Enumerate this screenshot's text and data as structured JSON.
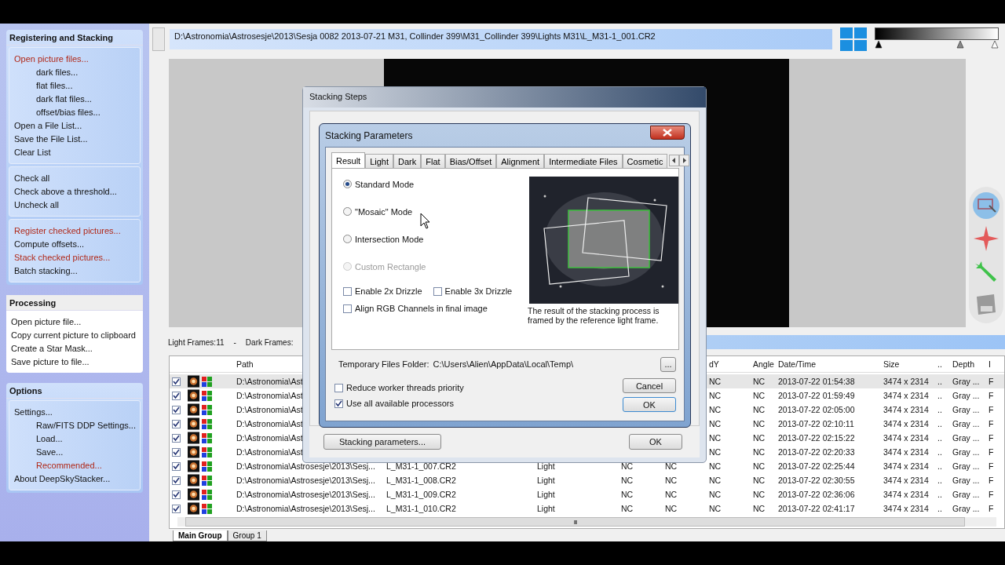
{
  "path_bar": {
    "text": "D:\\Astronomia\\Astrosesje\\2013\\Sesja 0082 2013-07-21 M31, Collinder 399\\M31_Collinder 399\\Lights M31\\L_M31-1_001.CR2"
  },
  "sidebar": [
    {
      "title": "Registering and Stacking",
      "kind": "blue",
      "groups": [
        {
          "items": [
            {
              "label": "Open picture files...",
              "highlighted": true,
              "children": [
                {
                  "label": "dark files...",
                  "highlighted": false
                },
                {
                  "label": "flat files...",
                  "highlighted": false
                },
                {
                  "label": "dark flat files...",
                  "highlighted": false
                },
                {
                  "label": "offset/bias files...",
                  "highlighted": false
                }
              ]
            },
            {
              "label": "Open a File List...",
              "highlighted": false
            },
            {
              "label": "Save the File List...",
              "highlighted": false
            },
            {
              "label": "Clear List",
              "highlighted": false
            }
          ]
        },
        {
          "items": [
            {
              "label": "Check all",
              "highlighted": false
            },
            {
              "label": "Check above a threshold...",
              "highlighted": false
            },
            {
              "label": "Uncheck all",
              "highlighted": false
            }
          ]
        },
        {
          "items": [
            {
              "label": "Register checked pictures...",
              "highlighted": true
            },
            {
              "label": "Compute offsets...",
              "highlighted": false
            },
            {
              "label": "Stack checked pictures...",
              "highlighted": true
            },
            {
              "label": "Batch stacking...",
              "highlighted": false
            }
          ]
        }
      ]
    },
    {
      "title": "Processing",
      "kind": "gray",
      "groups": [
        {
          "items": [
            {
              "label": "Open picture file...",
              "highlighted": false
            },
            {
              "label": "Copy current picture to clipboard",
              "highlighted": false
            },
            {
              "label": "Create a Star Mask...",
              "highlighted": false
            },
            {
              "label": "Save picture to file...",
              "highlighted": false
            }
          ]
        }
      ]
    },
    {
      "title": "Options",
      "kind": "blue",
      "groups": [
        {
          "items": [
            {
              "label": "Settings...",
              "highlighted": false,
              "children": [
                {
                  "label": "Raw/FITS DDP Settings...",
                  "highlighted": false
                },
                {
                  "label": "Load...",
                  "highlighted": false
                },
                {
                  "label": "Save...",
                  "highlighted": false
                },
                {
                  "label": "Recommended...",
                  "highlighted": true
                }
              ]
            },
            {
              "label": "About DeepSkyStacker...",
              "highlighted": false
            }
          ]
        }
      ]
    }
  ],
  "status": {
    "light_frames": "Light Frames:11",
    "separator": "-",
    "dark_frames": "Dark Frames:"
  },
  "table": {
    "columns": {
      "path": "Path",
      "dy": "dY",
      "angle": "Angle",
      "datetime": "Date/Time",
      "size": "Size",
      "dots": "..",
      "depth": "Depth",
      "column_12": "I"
    },
    "rows": [
      {
        "checked": true,
        "selected": true,
        "path": "D:\\Astronomia\\Ast",
        "dy": "NC",
        "angle": "NC",
        "datetime": "2013-07-22 01:54:38",
        "size": "3474 x 2314",
        "dots": "..",
        "depth": "Gray ...",
        "column_12": "F"
      },
      {
        "checked": true,
        "selected": false,
        "path": "D:\\Astronomia\\Ast",
        "dy": "NC",
        "angle": "NC",
        "datetime": "2013-07-22 01:59:49",
        "size": "3474 x 2314",
        "dots": "..",
        "depth": "Gray ...",
        "column_12": "F"
      },
      {
        "checked": true,
        "selected": false,
        "path": "D:\\Astronomia\\Ast",
        "dy": "NC",
        "angle": "NC",
        "datetime": "2013-07-22 02:05:00",
        "size": "3474 x 2314",
        "dots": "..",
        "depth": "Gray ...",
        "column_12": "F"
      },
      {
        "checked": true,
        "selected": false,
        "path": "D:\\Astronomia\\Ast",
        "dy": "NC",
        "angle": "NC",
        "datetime": "2013-07-22 02:10:11",
        "size": "3474 x 2314",
        "dots": "..",
        "depth": "Gray ...",
        "column_12": "F"
      },
      {
        "checked": true,
        "selected": false,
        "path": "D:\\Astronomia\\Ast",
        "dy": "NC",
        "angle": "NC",
        "datetime": "2013-07-22 02:15:22",
        "size": "3474 x 2314",
        "dots": "..",
        "depth": "Gray ...",
        "column_12": "F"
      },
      {
        "checked": true,
        "selected": false,
        "path": "D:\\Astronomia\\Ast",
        "dy": "NC",
        "angle": "NC",
        "datetime": "2013-07-22 02:20:33",
        "size": "3474 x 2314",
        "dots": "..",
        "depth": "Gray ...",
        "column_12": "F"
      },
      {
        "checked": true,
        "selected": false,
        "path": "D:\\Astronomia\\Astrosesje\\2013\\Sesj...",
        "column_2": "L_M31-1_007.CR2",
        "column_3": "Light",
        "column_4": "NC",
        "column_5": "NC",
        "dy": "NC",
        "angle": "NC",
        "datetime": "2013-07-22 02:25:44",
        "size": "3474 x 2314",
        "dots": "..",
        "depth": "Gray ...",
        "column_12": "F"
      },
      {
        "checked": true,
        "selected": false,
        "path": "D:\\Astronomia\\Astrosesje\\2013\\Sesj...",
        "column_2": "L_M31-1_008.CR2",
        "column_3": "Light",
        "column_4": "NC",
        "column_5": "NC",
        "dy": "NC",
        "angle": "NC",
        "datetime": "2013-07-22 02:30:55",
        "size": "3474 x 2314",
        "dots": "..",
        "depth": "Gray ...",
        "column_12": "F"
      },
      {
        "checked": true,
        "selected": false,
        "path": "D:\\Astronomia\\Astrosesje\\2013\\Sesj...",
        "column_2": "L_M31-1_009.CR2",
        "column_3": "Light",
        "column_4": "NC",
        "column_5": "NC",
        "dy": "NC",
        "angle": "NC",
        "datetime": "2013-07-22 02:36:06",
        "size": "3474 x 2314",
        "dots": "..",
        "depth": "Gray ...",
        "column_12": "F"
      },
      {
        "checked": true,
        "selected": false,
        "path": "D:\\Astronomia\\Astrosesje\\2013\\Sesj...",
        "column_2": "L_M31-1_010.CR2",
        "column_3": "Light",
        "column_4": "NC",
        "column_5": "NC",
        "dy": "NC",
        "angle": "NC",
        "datetime": "2013-07-22 02:41:17",
        "size": "3474 x 2314",
        "dots": "..",
        "depth": "Gray ...",
        "column_12": "F"
      }
    ]
  },
  "scroll_grip": "III",
  "gradient_slider": {
    "handles": [
      {
        "level": 0
      },
      {
        "level": 0.7
      },
      {
        "level": 1
      }
    ]
  },
  "group_tabs": [
    {
      "label": "Main Group",
      "selected": true
    },
    {
      "label": "Group 1",
      "selected": false
    }
  ],
  "stacking_steps": {
    "title": "Stacking Steps",
    "parameters_button": "Stacking parameters...",
    "ok_button": "OK"
  },
  "stacking_parameters": {
    "title": "Stacking Parameters",
    "tabs": [
      {
        "label": "Result",
        "selected": true
      },
      {
        "label": "Light",
        "selected": false
      },
      {
        "label": "Dark",
        "selected": false
      },
      {
        "label": "Flat",
        "selected": false
      },
      {
        "label": "Bias/Offset",
        "selected": false
      },
      {
        "label": "Alignment",
        "selected": false
      },
      {
        "label": "Intermediate Files",
        "selected": false
      },
      {
        "label": "Cosmetic",
        "selected": false
      }
    ],
    "modes": [
      {
        "label": "Standard Mode",
        "selected": true,
        "disabled": false
      },
      {
        "label": "\"Mosaic\" Mode",
        "selected": false,
        "disabled": false
      },
      {
        "label": "Intersection Mode",
        "selected": false,
        "disabled": false
      },
      {
        "label": "Custom Rectangle",
        "selected": false,
        "disabled": true
      }
    ],
    "drizzle": [
      {
        "label": "Enable 2x Drizzle",
        "checked": false
      },
      {
        "label": "Enable 3x Drizzle",
        "checked": false
      }
    ],
    "align_rgb": {
      "label": "Align RGB Channels in final image",
      "checked": false
    },
    "preview_caption": "The result of the stacking process is framed by the reference light frame.",
    "temp_folder_label": "Temporary Files Folder:",
    "temp_folder_path": "C:\\Users\\Alien\\AppData\\Local\\Temp\\",
    "browse_button": "...",
    "processing": [
      {
        "label": "Reduce worker threads priority",
        "checked": false
      },
      {
        "label": "Use all available processors",
        "checked": true
      }
    ],
    "cancel_button": "Cancel",
    "ok_button": "OK"
  }
}
